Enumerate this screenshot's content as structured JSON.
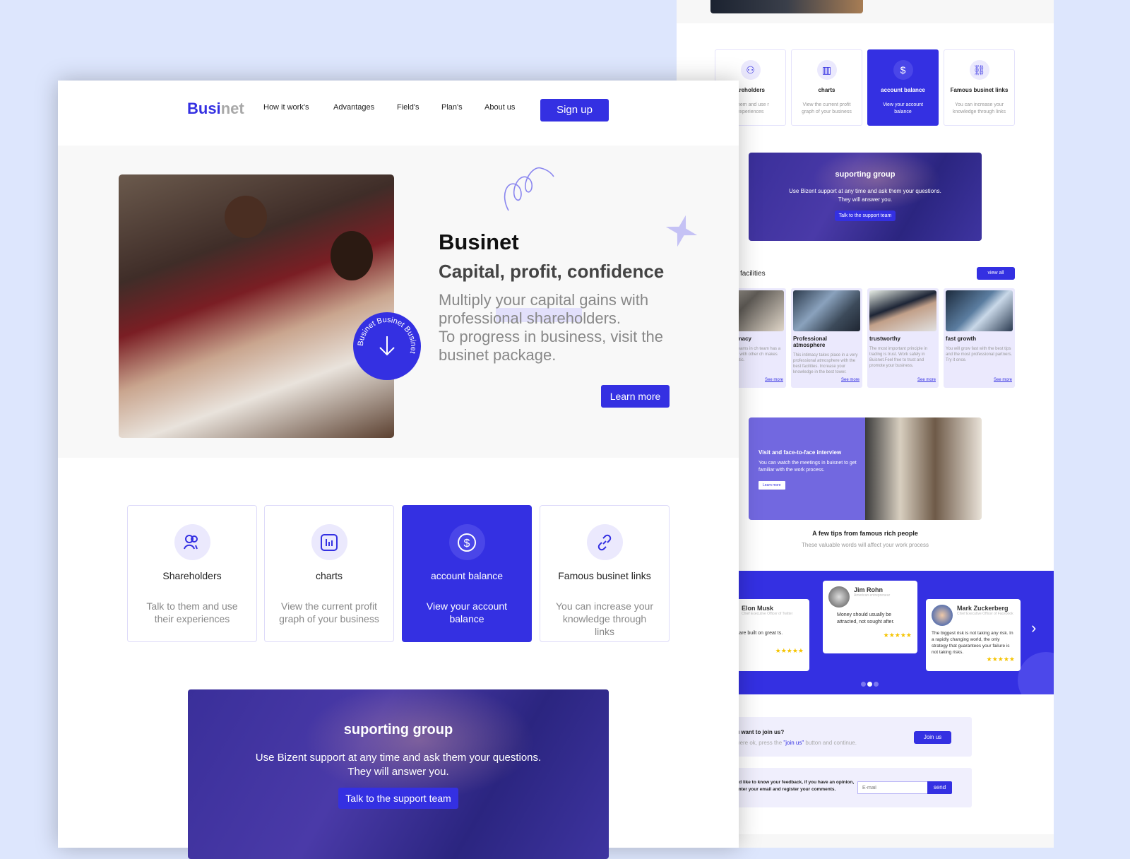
{
  "colors": {
    "accent": "#3430e2",
    "background": "#dde6fd",
    "light_accent": "#ebe9fd"
  },
  "nav": {
    "logo_a": "Busi",
    "logo_b": "net",
    "items": [
      "How it work's",
      "Advantages",
      "Field's",
      "Plan's",
      "About us"
    ],
    "signup": "Sign up"
  },
  "hero": {
    "title": "Businet",
    "subtitle": "Capital, profit, confidence",
    "paragraph1": "Multiply your capital gains with professional shareholders.",
    "paragraph2": "To progress in business, visit the businet package.",
    "learn_more": "Learn more",
    "badge_text": "Businet Businet Businet ",
    "badge_icon": "arrow-down-icon"
  },
  "features": [
    {
      "icon": "users-icon",
      "title": "Shareholders",
      "desc": "Talk to them and use their experiences"
    },
    {
      "icon": "chart-icon",
      "title": "charts",
      "desc": "View the current profit graph of your business"
    },
    {
      "icon": "dollar-icon",
      "title": "account balance",
      "desc": "View your account balance",
      "active": true
    },
    {
      "icon": "link-icon",
      "title": "Famous businet links",
      "desc": "You can increase your knowledge through links"
    }
  ],
  "right_features": [
    {
      "title": "areholders",
      "desc": "o them and use r experiences"
    },
    {
      "title": "charts",
      "desc": "View the current profit graph of your business"
    },
    {
      "title": "account balance",
      "desc": "View your account balance"
    },
    {
      "title": "Famous businet links",
      "desc": "You can increase your knowledge through links"
    }
  ],
  "support": {
    "title": "suporting group",
    "text1": "Use Bizent support at any time and ask them your questions.",
    "text2": "They will answer you.",
    "button": "Talk to the support team"
  },
  "facilities": {
    "title": "facilities",
    "view_all": "view all",
    "items": [
      {
        "title": "and intimacy",
        "desc": "e the best teams in ch team has a very onship with other ch makes people isiastic.",
        "link": "See more"
      },
      {
        "title": "Professional atmosphere",
        "desc": "This intimacy takes place in a very professional atmosphere with the best facilities. Increase your knowledge in the best tower.",
        "link": "See more"
      },
      {
        "title": "trustworthy",
        "desc": "The most important principle in trading is trust. Work safely in Buisnet.Feel free to trust and promote your business.",
        "link": "See more"
      },
      {
        "title": "fast growth",
        "desc": "You will grow fast with the best tips and the most professional partners. Try it once.",
        "link": "See more"
      }
    ]
  },
  "interview": {
    "title": "Visit and face-to-face interview",
    "text": "You can watch the meetings in buisnet to get familiar with the work process.",
    "button": "Learn more"
  },
  "tips": {
    "title": "A few tips from famous rich people",
    "subtitle": "These valuable words will affect your work process"
  },
  "testimonials": [
    {
      "name": "Elon Musk",
      "role": "Chief Executive Officer of Twitter",
      "quote": "ompanies are built on great ts.",
      "stars": 5
    },
    {
      "name": "Jim Rohn",
      "role": "American entrepreneur",
      "quote": "Money should usually be attracted, not sought after.",
      "stars": 5
    },
    {
      "name": "Mark Zuckerberg",
      "role": "Chief Executive Officer of Facebook",
      "quote": "The biggest risk is not taking any risk. In a rapidly changing world, the only strategy that guarantees your failure is not taking risks.",
      "stars": 5
    }
  ],
  "carousel": {
    "active_dot": 2,
    "dots": 3,
    "next_icon": "chevron-right-icon"
  },
  "join": {
    "title": "Do you want to join us?",
    "text_a": "If you were ok, press the ",
    "text_link": "\"join us\"",
    "text_b": " button and continue.",
    "button": "Join us"
  },
  "feedback": {
    "text": "We would like to know your feedback, if you have an opinion, please enter your email and register your comments.",
    "placeholder": "E-mail",
    "button": "send"
  }
}
